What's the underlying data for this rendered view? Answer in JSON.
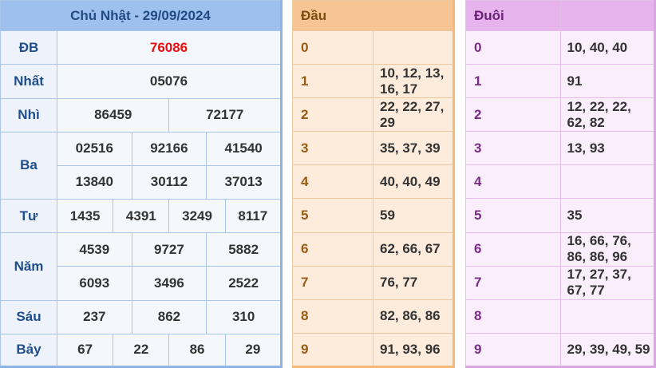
{
  "results": {
    "title": "Chủ Nhật - 29/09/2024",
    "rows": {
      "db": {
        "label": "ĐB",
        "values": [
          "76086"
        ]
      },
      "nhat": {
        "label": "Nhất",
        "values": [
          "05076"
        ]
      },
      "nhi": {
        "label": "Nhì",
        "values": [
          "86459",
          "72177"
        ]
      },
      "ba": {
        "label": "Ba",
        "values": [
          "02516",
          "92166",
          "41540",
          "13840",
          "30112",
          "37013"
        ]
      },
      "tu": {
        "label": "Tư",
        "values": [
          "1435",
          "4391",
          "3249",
          "8117"
        ]
      },
      "nam": {
        "label": "Năm",
        "values": [
          "4539",
          "9727",
          "5882",
          "6093",
          "3496",
          "2522"
        ]
      },
      "sau": {
        "label": "Sáu",
        "values": [
          "237",
          "862",
          "310"
        ]
      },
      "bay": {
        "label": "Bảy",
        "values": [
          "67",
          "22",
          "86",
          "29"
        ]
      }
    }
  },
  "dau": {
    "header": "Đầu",
    "rows": [
      {
        "k": "0",
        "v": ""
      },
      {
        "k": "1",
        "v": "10, 12, 13, 16, 17"
      },
      {
        "k": "2",
        "v": "22, 22, 27, 29"
      },
      {
        "k": "3",
        "v": "35, 37, 39"
      },
      {
        "k": "4",
        "v": "40, 40, 49"
      },
      {
        "k": "5",
        "v": "59"
      },
      {
        "k": "6",
        "v": "62, 66, 67"
      },
      {
        "k": "7",
        "v": "76, 77"
      },
      {
        "k": "8",
        "v": "82, 86, 86"
      },
      {
        "k": "9",
        "v": "91, 93, 96"
      }
    ]
  },
  "duoi": {
    "header": "Đuôi",
    "rows": [
      {
        "k": "0",
        "v": "10, 40, 40"
      },
      {
        "k": "1",
        "v": "91"
      },
      {
        "k": "2",
        "v": "12, 22, 22, 62, 82"
      },
      {
        "k": "3",
        "v": "13, 93"
      },
      {
        "k": "4",
        "v": ""
      },
      {
        "k": "5",
        "v": "35"
      },
      {
        "k": "6",
        "v": "16, 66, 76, 86, 86, 96"
      },
      {
        "k": "7",
        "v": "17, 27, 37, 67, 77"
      },
      {
        "k": "8",
        "v": ""
      },
      {
        "k": "9",
        "v": "29, 39, 49, 59"
      }
    ]
  },
  "colors": {
    "special_prize": "#e61010",
    "results_header": "#9ec0ee",
    "dau_header": "#f7c594",
    "duoi_header": "#e6b3ec"
  }
}
